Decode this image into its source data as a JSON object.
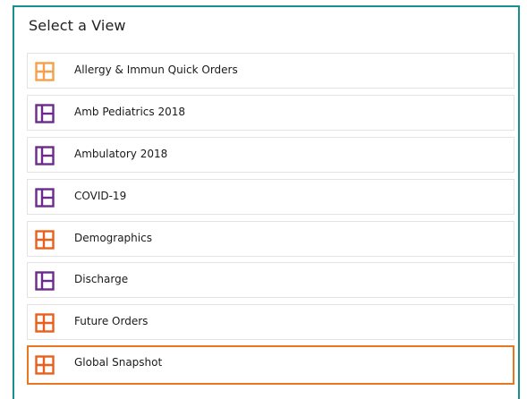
{
  "dialog": {
    "title": "Select a View"
  },
  "colors": {
    "accent_teal": "#1a8f8f",
    "selected_border": "#e87722",
    "orange_light": "#f5a04a",
    "orange": "#e8601c",
    "purple": "#6b2a8c"
  },
  "views": [
    {
      "label": "Allergy & Immun Quick Orders",
      "icon": "quadrant-layout-icon",
      "icon_color": "#f5a04a",
      "selected": false
    },
    {
      "label": "Amb Pediatrics 2018",
      "icon": "split-layout-icon",
      "icon_color": "#6b2a8c",
      "selected": false
    },
    {
      "label": "Ambulatory 2018",
      "icon": "split-layout-icon",
      "icon_color": "#6b2a8c",
      "selected": false
    },
    {
      "label": "COVID-19",
      "icon": "split-layout-icon",
      "icon_color": "#6b2a8c",
      "selected": false
    },
    {
      "label": "Demographics",
      "icon": "quadrant-layout-icon",
      "icon_color": "#e8601c",
      "selected": false
    },
    {
      "label": "Discharge",
      "icon": "split-layout-icon",
      "icon_color": "#6b2a8c",
      "selected": false
    },
    {
      "label": "Future Orders",
      "icon": "quadrant-layout-icon",
      "icon_color": "#e8601c",
      "selected": false
    },
    {
      "label": "Global Snapshot",
      "icon": "quadrant-layout-icon",
      "icon_color": "#e8601c",
      "selected": true
    }
  ]
}
